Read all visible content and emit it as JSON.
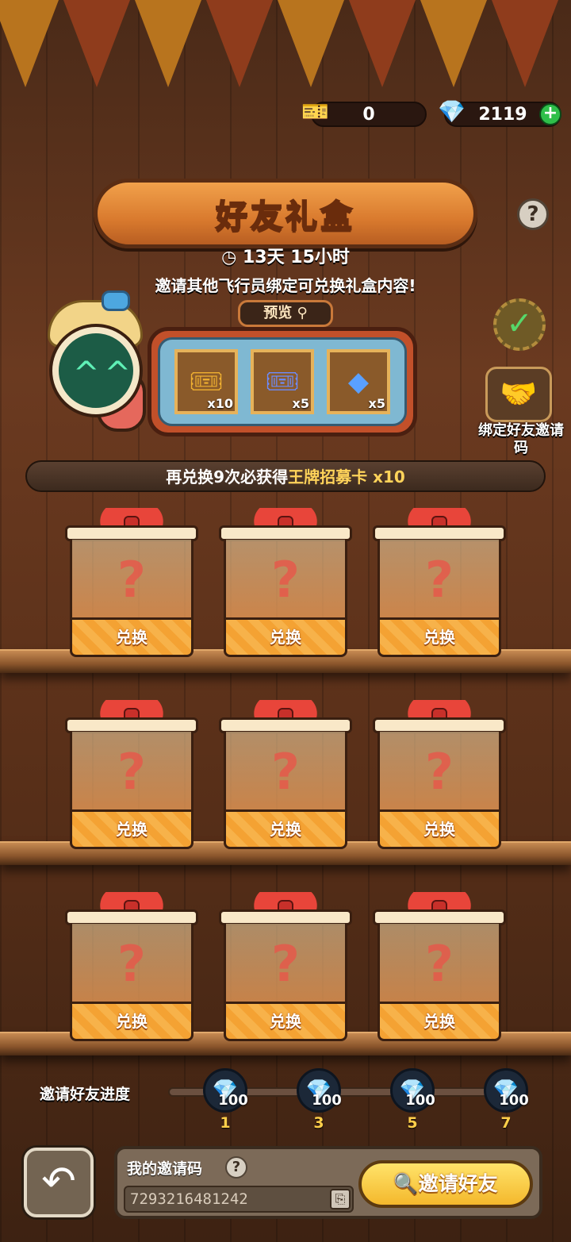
{
  "currency": {
    "ticket_icon": "ticket-icon",
    "ticket_amount": "0",
    "diamond_icon": "diamond-icon",
    "diamond_amount": "2119",
    "add_icon": "plus-icon"
  },
  "header": {
    "title": "好友礼盒",
    "timer": "13天 15小时",
    "description": "邀请其他飞行员绑定可兑换礼盒内容!"
  },
  "preview": {
    "tab_label": "预览",
    "items": [
      {
        "icon": "gold-ticket-icon",
        "qty": "x10"
      },
      {
        "icon": "blue-ticket-icon",
        "qty": "x5"
      },
      {
        "icon": "cube-icon",
        "qty": "x5"
      }
    ]
  },
  "side": {
    "bind_label": "绑定好友邀请码"
  },
  "guarantee": {
    "prefix": "再兑换9次必获得",
    "highlight": "王牌招募卡 x10"
  },
  "gifts": [
    {
      "label": "兑换"
    },
    {
      "label": "兑换"
    },
    {
      "label": "兑换"
    },
    {
      "label": "兑换"
    },
    {
      "label": "兑换"
    },
    {
      "label": "兑换"
    },
    {
      "label": "兑换"
    },
    {
      "label": "兑换"
    },
    {
      "label": "兑换"
    }
  ],
  "progress": {
    "label": "邀请好友进度",
    "milestones": [
      {
        "amount": "100",
        "count": "1"
      },
      {
        "amount": "100",
        "count": "3"
      },
      {
        "amount": "100",
        "count": "5"
      },
      {
        "amount": "100",
        "count": "7"
      }
    ]
  },
  "bottom": {
    "code_label": "我的邀请码",
    "code_value": "7293216481242",
    "invite_button": "邀请好友"
  },
  "colors": {
    "accent_orange": "#f4a233",
    "highlight_yellow": "#ffd35a",
    "milestone_gold": "#ffcf4a"
  }
}
